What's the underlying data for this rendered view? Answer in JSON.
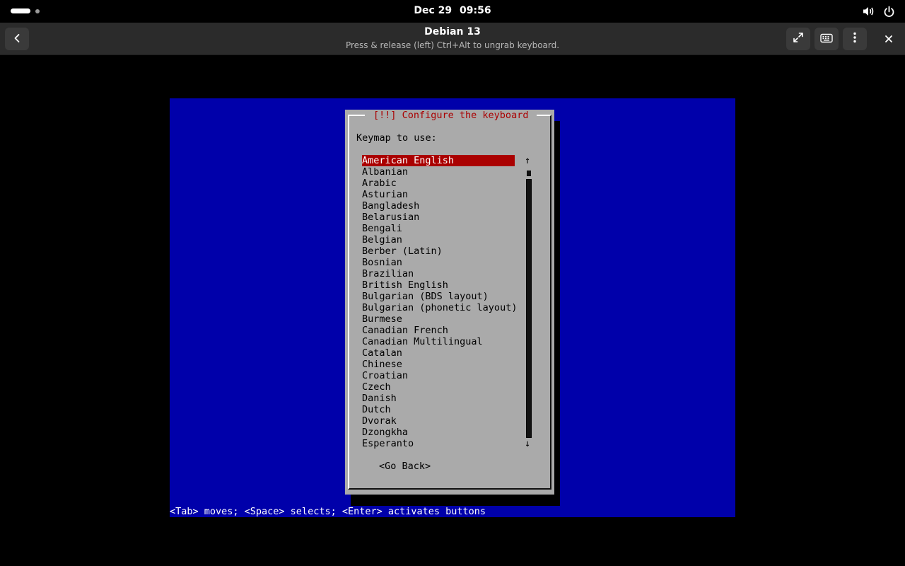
{
  "topbar": {
    "date": "Dec 29",
    "time": "09:56",
    "icons": [
      "activities-pill-icon",
      "volume-icon",
      "power-icon"
    ]
  },
  "headerbar": {
    "title": "Debian 13",
    "subtitle": "Press & release (left) Ctrl+Alt to ungrab keyboard.",
    "icons": [
      "back-arrow-icon",
      "fullscreen-icon",
      "keyboard-icon",
      "kebab-menu-icon",
      "close-icon"
    ]
  },
  "installer": {
    "dialog_title": "[!!] Configure the keyboard",
    "prompt": "Keymap to use:",
    "selected_index": 0,
    "keymaps": [
      "American English",
      "Albanian",
      "Arabic",
      "Asturian",
      "Bangladesh",
      "Belarusian",
      "Bengali",
      "Belgian",
      "Berber (Latin)",
      "Bosnian",
      "Brazilian",
      "British English",
      "Bulgarian (BDS layout)",
      "Bulgarian (phonetic layout)",
      "Burmese",
      "Canadian French",
      "Canadian Multilingual",
      "Catalan",
      "Chinese",
      "Croatian",
      "Czech",
      "Danish",
      "Dutch",
      "Dvorak",
      "Dzongkha",
      "Esperanto"
    ],
    "go_back": "<Go Back>",
    "help_line": "<Tab> moves; <Space> selects; <Enter> activates buttons"
  },
  "colors": {
    "vm_background": "#0000aa",
    "dialog_background": "#aaaaaa",
    "selection": "#aa0000",
    "title_text": "#aa0000"
  }
}
